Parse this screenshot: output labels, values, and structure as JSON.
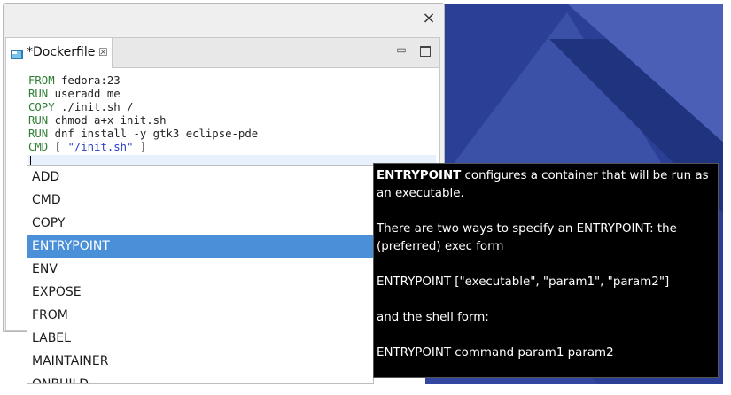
{
  "window": {
    "close_glyph": "×"
  },
  "editor": {
    "tab": {
      "title": "*Dockerfile",
      "close_glyph": "☒"
    },
    "minimize_glyph": "▭",
    "lines": [
      {
        "kw": "FROM",
        "rest": " fedora:23"
      },
      {
        "kw": "RUN",
        "rest": " useradd me"
      },
      {
        "kw": "COPY",
        "rest": " ./init.sh /"
      },
      {
        "kw": "RUN",
        "rest": " chmod a+x init.sh"
      },
      {
        "kw": "RUN",
        "rest": " dnf install -y gtk3 eclipse-pde"
      },
      {
        "kw": "CMD",
        "rest_pre": " [ ",
        "str": "\"/init.sh\"",
        "rest_post": " ]"
      }
    ]
  },
  "content_assist": {
    "proposals": [
      "ADD",
      "CMD",
      "COPY",
      "ENTRYPOINT",
      "ENV",
      "EXPOSE",
      "FROM",
      "LABEL",
      "MAINTAINER",
      "ONBUILD"
    ],
    "selected_index": 3
  },
  "info": {
    "p1_bold": "ENTRYPOINT",
    "p1_rest": " configures a container that will be run as an executable.",
    "p2": "There are two ways to specify an ENTRYPOINT: the (preferred) exec form",
    "p3": "ENTRYPOINT [\"executable\", \"param1\", \"param2\"]",
    "p4": "and the shell form:",
    "p5": "ENTRYPOINT command param1 param2"
  },
  "colors": {
    "keyword": "#2e7d32",
    "string": "#2a3fc7",
    "selection": "#4a90d9",
    "desktop": "#2b3f96"
  }
}
